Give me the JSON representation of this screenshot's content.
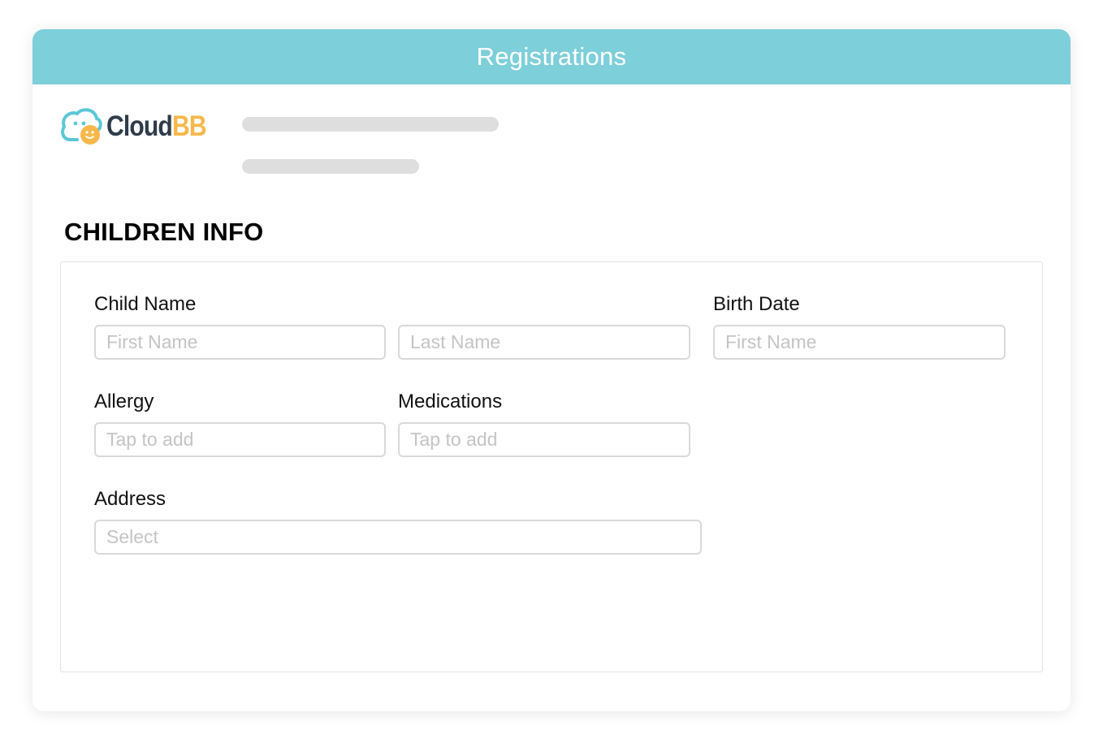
{
  "header": {
    "title": "Registrations"
  },
  "logo": {
    "word_primary": "Cloud",
    "word_accent": "BB",
    "icon": "smiley-cloud-icon",
    "colors": {
      "primary": "#2f3c4a",
      "accent": "#f7b84b",
      "icon_outline": "#5cc7d6"
    }
  },
  "section": {
    "title": "CHILDREN INFO"
  },
  "form": {
    "child_name": {
      "label": "Child Name",
      "first_placeholder": "First Name",
      "last_placeholder": "Last Name"
    },
    "birth_date": {
      "label": "Birth Date",
      "placeholder": "First Name"
    },
    "allergy": {
      "label": "Allergy",
      "placeholder": "Tap to add"
    },
    "medications": {
      "label": "Medications",
      "placeholder": "Tap to add"
    },
    "address": {
      "label": "Address",
      "placeholder": "Select"
    }
  },
  "colors": {
    "header_bg": "#7dcfd9",
    "input_border": "#d9d9d9",
    "placeholder": "#c4c4c4",
    "skeleton": "#dedede"
  }
}
